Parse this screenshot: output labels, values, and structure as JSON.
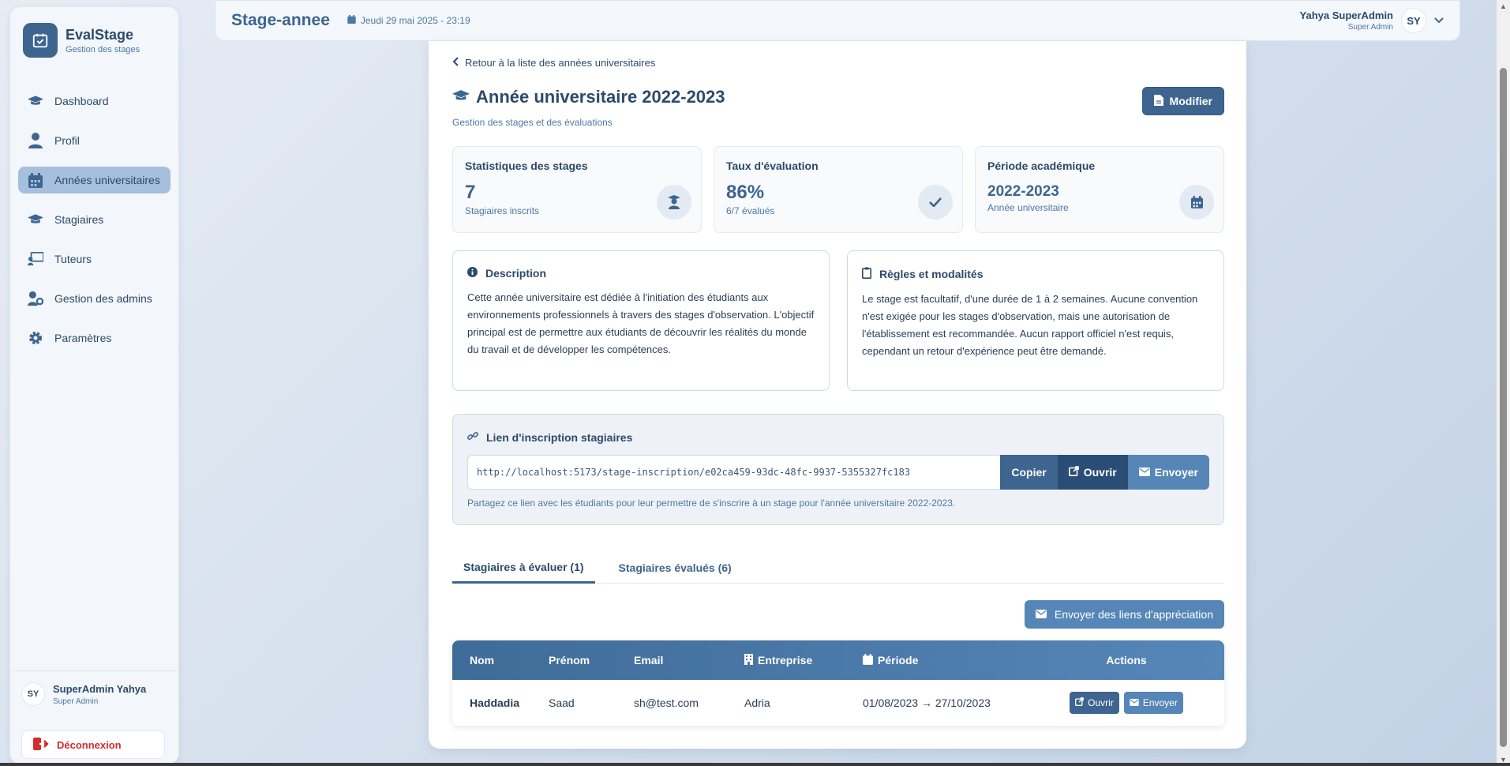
{
  "app": {
    "name": "EvalStage",
    "tagline": "Gestion des stages"
  },
  "sidebar": {
    "items": [
      {
        "label": "Dashboard",
        "icon": "graduation-cap-icon"
      },
      {
        "label": "Profil",
        "icon": "user-icon"
      },
      {
        "label": "Années universitaires",
        "icon": "calendar-icon"
      },
      {
        "label": "Stagiaires",
        "icon": "graduation-cap-icon"
      },
      {
        "label": "Tuteurs",
        "icon": "chalkboard-teacher-icon"
      },
      {
        "label": "Gestion des admins",
        "icon": "user-gear-icon"
      },
      {
        "label": "Paramètres",
        "icon": "gear-icon"
      }
    ],
    "active_index": 2,
    "user": {
      "initials": "SY",
      "name": "SuperAdmin Yahya",
      "role": "Super Admin"
    },
    "logout_label": "Déconnexion"
  },
  "topbar": {
    "title": "Stage-annee",
    "date": "Jeudi 29 mai 2025 - 23:19",
    "user_name": "Yahya SuperAdmin",
    "user_role": "Super Admin",
    "user_initials": "SY"
  },
  "main": {
    "back_label": "Retour à la liste des années universitaires",
    "title": "Année universitaire 2022-2023",
    "subtitle": "Gestion des stages et des évaluations",
    "edit_label": "Modifier",
    "stats": [
      {
        "label": "Statistiques des stages",
        "value": "7",
        "sub": "Stagiaires inscrits",
        "icon": "user-graduate-icon"
      },
      {
        "label": "Taux d'évaluation",
        "value": "86%",
        "sub": "6/7 évalués",
        "icon": "check-icon"
      },
      {
        "label": "Période académique",
        "value": "2022-2023",
        "sub": "Année universitaire",
        "icon": "calendar-icon"
      }
    ],
    "description": {
      "title": "Description",
      "text": "Cette année universitaire est dédiée à l'initiation des étudiants aux environnements professionnels à travers des stages d'observation. L'objectif principal est de permettre aux étudiants de découvrir les réalités du monde du travail et de développer les compétences."
    },
    "rules": {
      "title": "Règles et modalités",
      "text": "Le stage est facultatif, d'une durée de 1 à 2 semaines. Aucune convention n'est exigée pour les stages d'observation, mais une autorisation de l'établissement est recommandée. Aucun rapport officiel n'est requis, cependant un retour d'expérience peut être demandé."
    },
    "signup_link": {
      "title": "Lien d'inscription stagiaires",
      "url": "http://localhost:5173/stage-inscription/e02ca459-93dc-48fc-9937-5355327fc183",
      "copy_label": "Copier",
      "open_label": "Ouvrir",
      "send_label": "Envoyer",
      "help": "Partagez ce lien avec les étudiants pour leur permettre de s'inscrire à un stage pour l'année universitaire 2022-2023."
    },
    "tabs": [
      {
        "label": "Stagiaires à évaluer (1)",
        "active": true
      },
      {
        "label": "Stagiaires évalués (6)",
        "active": false
      }
    ],
    "send_links_label": "Envoyer des liens d'appréciation",
    "table": {
      "headers": {
        "nom": "Nom",
        "prenom": "Prénom",
        "email": "Email",
        "entreprise": "Entreprise",
        "periode": "Période",
        "actions": "Actions"
      },
      "rows": [
        {
          "nom": "Haddadia",
          "prenom": "Saad",
          "email": "sh@test.com",
          "entreprise": "Adria",
          "periode": "01/08/2023 → 27/10/2023",
          "open_label": "Ouvrir",
          "send_label": "Envoyer"
        }
      ]
    }
  },
  "colors": {
    "primary": "#3d6590",
    "primary_dark": "#2a4d75",
    "primary_light": "#5686b8",
    "danger": "#d12e2e"
  }
}
